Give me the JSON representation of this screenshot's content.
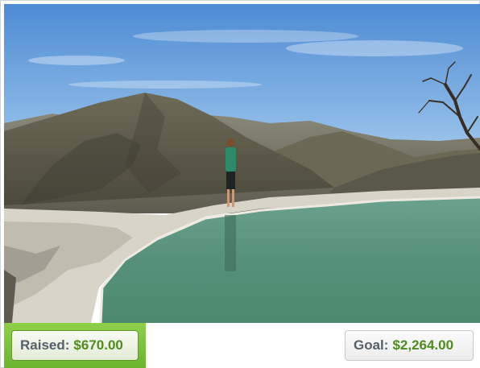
{
  "hero": {
    "image": "landscape photo: woman standing at edge of infinity pool overlooking mountains"
  },
  "fundraising": {
    "raised_label": "Raised:",
    "raised_amount": "$670.00",
    "goal_label": "Goal:",
    "goal_amount": "$2,264.00"
  },
  "colors": {
    "raised_background": "#7bc23a",
    "amount_green": "#4e8c1f",
    "label_gray": "#55606a"
  }
}
